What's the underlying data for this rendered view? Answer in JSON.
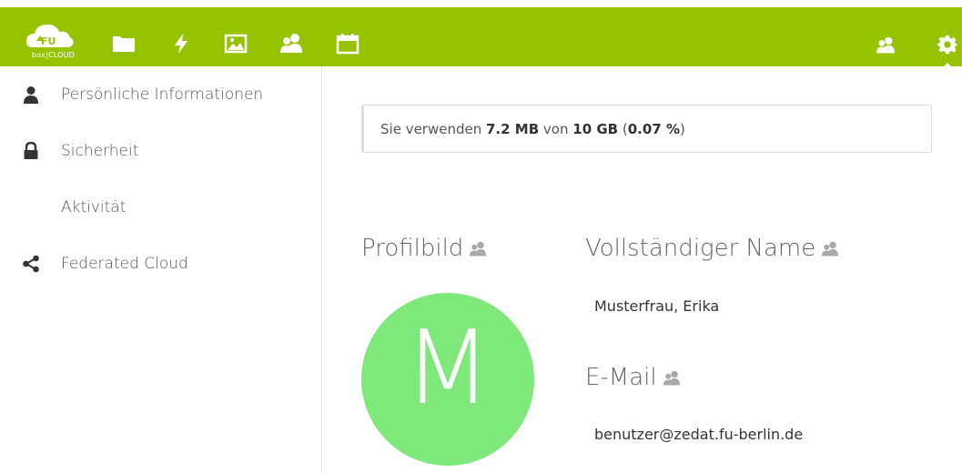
{
  "header": {
    "logo_text": "box|CLOUD",
    "brand_color": "#95c300",
    "nav_icons": [
      "files-folder-icon",
      "activity-bolt-icon",
      "gallery-image-icon",
      "contacts-users-icon",
      "calendar-icon"
    ],
    "right_icons": [
      "contacts-users-icon",
      "settings-gear-icon"
    ]
  },
  "sidebar": {
    "items": [
      {
        "label": "Persönliche Informationen",
        "icon": "user-icon"
      },
      {
        "label": "Sicherheit",
        "icon": "lock-icon"
      },
      {
        "label": "Aktivität",
        "icon": ""
      },
      {
        "label": "Federated Cloud",
        "icon": "share-icon"
      }
    ]
  },
  "quota": {
    "prefix": "Sie verwenden ",
    "used": "7.2 MB",
    "mid": " von ",
    "total": "10 GB",
    "open": " (",
    "percent": "0.07 %",
    "close": ")"
  },
  "profile": {
    "picture_title": "Profilbild",
    "avatar_letter": "M",
    "avatar_color": "#7ee87b",
    "name_title": "Vollständiger Name",
    "name_value": "Musterfrau, Erika",
    "email_title": "E-Mail",
    "email_value": "benutzer@zedat.fu-berlin.de"
  }
}
